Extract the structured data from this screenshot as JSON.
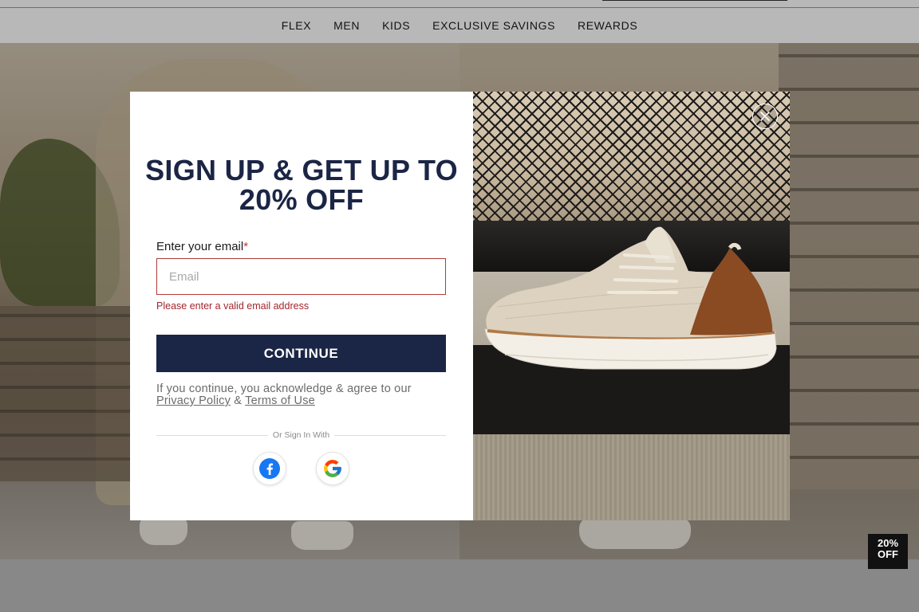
{
  "nav": {
    "items": [
      {
        "label": "FLEX"
      },
      {
        "label": "MEN"
      },
      {
        "label": "KIDS"
      },
      {
        "label": "EXCLUSIVE SAVINGS"
      },
      {
        "label": "REWARDS"
      }
    ]
  },
  "modal": {
    "title": "SIGN UP & GET UP TO 20% OFF",
    "email_label": "Enter your email",
    "required_marker": "*",
    "email_placeholder": "Email",
    "email_value": "",
    "error_text": "Please enter a valid email address",
    "continue_label": "CONTINUE",
    "legal_prefix": "If you continue, you acknowledge & agree to our",
    "privacy_link": "Privacy Policy",
    "legal_and": "&",
    "terms_link": "Terms of Use",
    "divider_text": "Or Sign In With",
    "social": [
      {
        "name": "facebook-icon"
      },
      {
        "name": "google-icon"
      }
    ],
    "close_icon": "close-icon"
  },
  "badge": {
    "line1": "20%",
    "line2": "OFF"
  },
  "colors": {
    "brand_navy": "#1b2545",
    "error_red": "#a3262b",
    "facebook_blue": "#1877F2"
  }
}
